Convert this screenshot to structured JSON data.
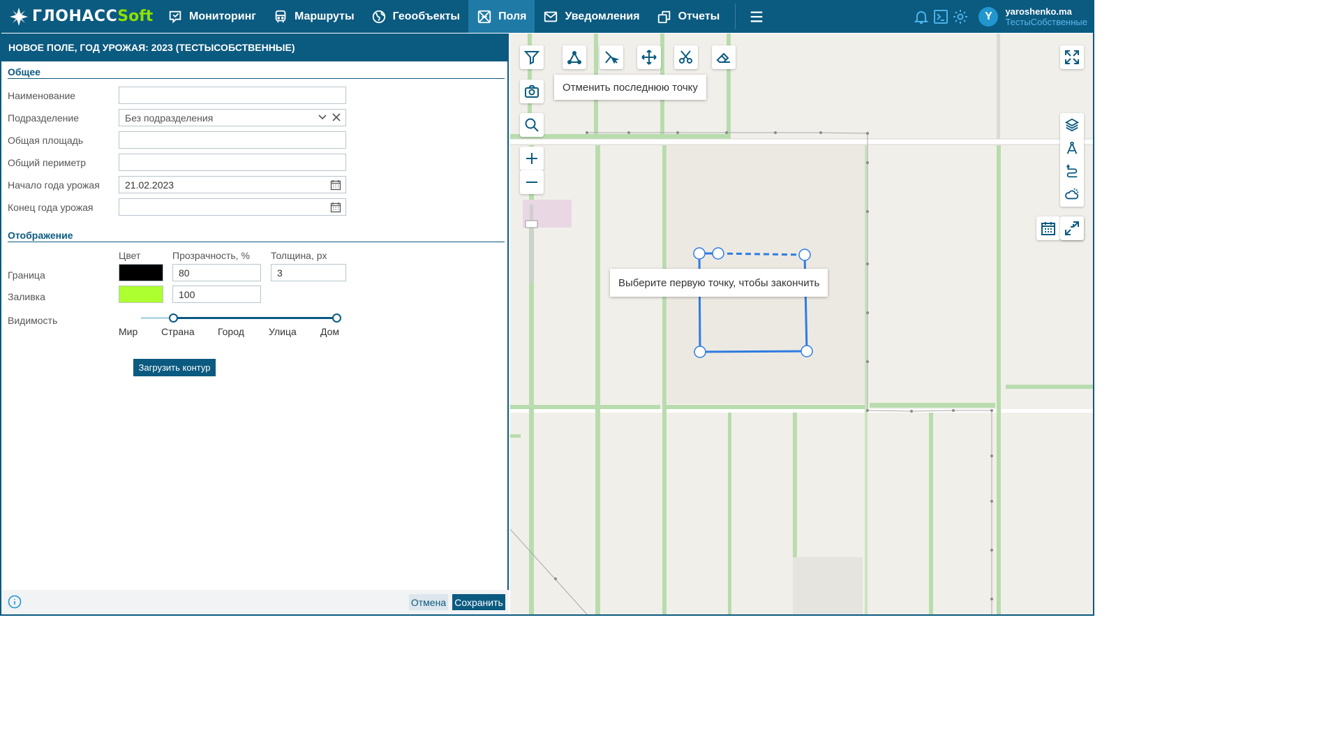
{
  "app": {
    "logo_main": "ГЛОНАСС",
    "logo_soft": "Soft"
  },
  "nav": [
    {
      "label": "Мониторинг",
      "icon": "monitor-icon"
    },
    {
      "label": "Маршруты",
      "icon": "bus-icon"
    },
    {
      "label": "Геообъекты",
      "icon": "globe-icon"
    },
    {
      "label": "Поля",
      "icon": "field-icon",
      "active": true
    },
    {
      "label": "Уведомления",
      "icon": "mail-icon"
    },
    {
      "label": "Отчеты",
      "icon": "reports-icon"
    }
  ],
  "user": {
    "login": "yaroshenko.ma",
    "company": "ТестыСобственные",
    "avatar_letter": "Y"
  },
  "panel": {
    "title": "НОВОЕ ПОЛЕ, ГОД УРОЖАЯ: 2023 (ТЕСТЫСОБСТВЕННЫЕ)",
    "general": {
      "title": "Общее",
      "name_label": "Наименование",
      "name_value": "",
      "division_label": "Подразделение",
      "division_value": "Без подразделения",
      "area_label": "Общая площадь",
      "area_value": "",
      "perimeter_label": "Общий периметр",
      "perimeter_value": "",
      "start_label": "Начало года урожая",
      "start_value": "21.02.2023",
      "end_label": "Конец года урожая",
      "end_value": ""
    },
    "display": {
      "title": "Отображение",
      "col_color": "Цвет",
      "col_opacity": "Прозрачность, %",
      "col_thickness": "Толщина, px",
      "border_label": "Граница",
      "border_color": "#000000",
      "border_opacity": "80",
      "border_thickness": "3",
      "fill_label": "Заливка",
      "fill_color": "#adff2f",
      "fill_opacity": "100",
      "visibility_label": "Видимость",
      "visibility_ticks": [
        "Мир",
        "Страна",
        "Город",
        "Улица",
        "Дом"
      ],
      "visibility_from": "Страна",
      "visibility_to": "Дом"
    },
    "load_button": "Загрузить контур",
    "cancel_button": "Отмена",
    "save_button": "Сохранить"
  },
  "map": {
    "undo_tooltip": "Отменить последнюю точку",
    "finish_tooltip": "Выберите первую точку, чтобы закончить"
  },
  "colors": {
    "brand": "#0b5a80",
    "accent": "#8ee000",
    "draw_line": "#2f7be0"
  }
}
